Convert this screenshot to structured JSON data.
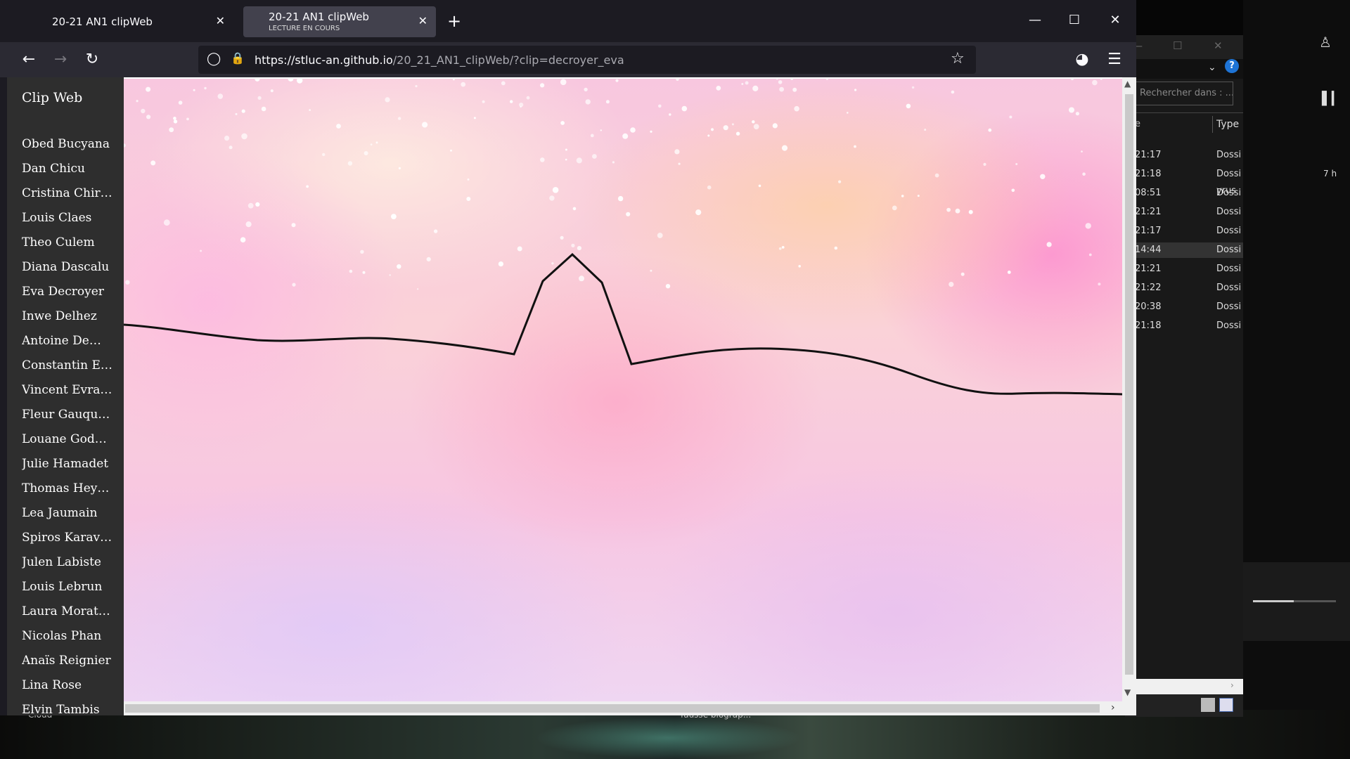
{
  "browser": {
    "tabs": [
      {
        "title": "20-21 AN1 clipWeb",
        "subtitle": ""
      },
      {
        "title": "20-21 AN1 clipWeb",
        "subtitle": "LECTURE EN COURS"
      }
    ],
    "url_host": "https://stluc-an.github.io",
    "url_path": "/20_21_AN1_clipWeb/?clip=decroyer_eva"
  },
  "page": {
    "brand": "Clip Web",
    "students": [
      "Obed Bucyana",
      "Dan Chicu",
      "Cristina Chir…",
      "Louis Claes",
      "Theo Culem",
      "Diana Dascalu",
      "Eva Decroyer",
      "Inwe Delhez",
      "Antoine De…",
      "Constantin E…",
      "Vincent Evrard",
      "Fleur Gauquier",
      "Louane God…",
      "Julie Hamadet",
      "Thomas Hey…",
      "Lea Jaumain",
      "Spiros Karav…",
      "Julen Labiste",
      "Louis Lebrun",
      "Laura Morat…",
      "Nicolas Phan",
      "Anaïs Reignier",
      "Lina Rose",
      "Elvin Tambis"
    ]
  },
  "background_app": {
    "search_placeholder": "Rechercher dans : ...",
    "column_type": "Type",
    "column_date_fragment": "e",
    "rows": [
      {
        "time": "21:17",
        "type": "Dossi"
      },
      {
        "time": "21:18",
        "type": "Dossi"
      },
      {
        "time": "08:51",
        "type": "Dossi"
      },
      {
        "time": "21:21",
        "type": "Dossi"
      },
      {
        "time": "21:17",
        "type": "Dossi"
      },
      {
        "time": "14:44",
        "type": "Dossi"
      },
      {
        "time": "21:21",
        "type": "Dossi"
      },
      {
        "time": "21:22",
        "type": "Dossi"
      },
      {
        "time": "20:38",
        "type": "Dossi"
      },
      {
        "time": "21:18",
        "type": "Dossi"
      }
    ],
    "side_text_time": "7 h",
    "side_text_yrus": "yrus",
    "desktop_label_left": "Cloud",
    "desktop_label_center": "fausse biograp..."
  },
  "icons": {
    "back": "arrow-left-icon",
    "forward": "arrow-right-icon",
    "reload": "reload-icon",
    "shield": "tracking-protection-icon",
    "lock": "lock-icon",
    "star": "bookmark-star-icon",
    "pocket": "pocket-icon",
    "menu": "hamburger-menu-icon"
  },
  "colors": {
    "chrome_dark": "#1c1b22",
    "toolbar": "#2b2a33",
    "active_tab": "#42414d",
    "sidebar": "#2e2e2e"
  }
}
